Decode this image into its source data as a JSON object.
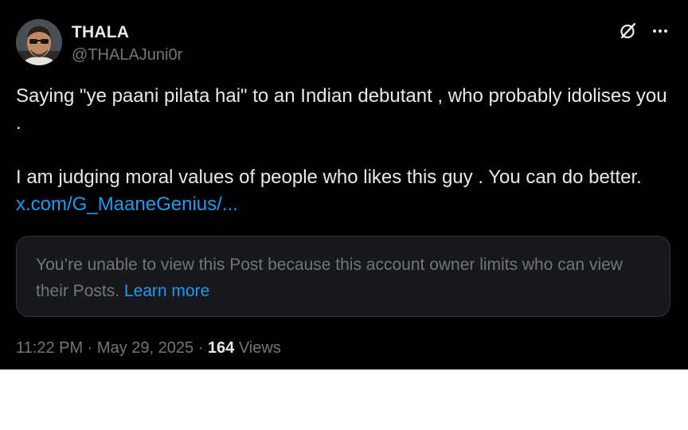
{
  "author": {
    "display_name": "THALA",
    "handle": "@THALAJuni0r"
  },
  "post": {
    "line1": "Saying \"ye paani pilata hai\" to an Indian debutant , who probably idolises you .",
    "line2": " I am judging moral values of people who likes this guy . You can do better. ",
    "link_text": "x.com/G_MaaneGenius/..."
  },
  "quoted_post": {
    "notice": "You’re unable to view this Post because this account owner limits who can view their Posts. ",
    "learn_more_label": "Learn more"
  },
  "meta": {
    "time": "11:22 PM",
    "separator1": " · ",
    "date": "May 29, 2025",
    "separator2": " · ",
    "view_count": "164",
    "views_label": " Views"
  },
  "icons": {
    "grok": "grok-icon",
    "more": "more-options-icon",
    "avatar": "avatar"
  },
  "colors": {
    "background": "#000000",
    "text": "#e7e9ea",
    "muted": "#71767b",
    "link": "#1d9bf0",
    "card": "#16181c"
  }
}
